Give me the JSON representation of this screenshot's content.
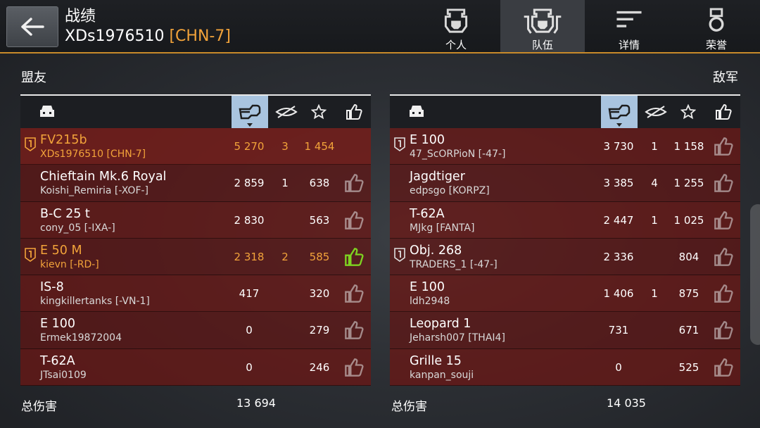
{
  "header": {
    "title": "战绩",
    "player": "XDs1976510",
    "clan": "[CHN-7]",
    "tabs": [
      {
        "label": "个人",
        "icon": "personal-helmet-icon"
      },
      {
        "label": "队伍",
        "icon": "team-helmets-icon"
      },
      {
        "label": "详情",
        "icon": "details-lines-icon"
      },
      {
        "label": "荣誉",
        "icon": "honor-medal-icon"
      }
    ],
    "active_tab": "队伍"
  },
  "allies": {
    "label": "盟友",
    "total_label": "总伤害",
    "total_damage": "13 694",
    "rows": [
      {
        "tank": "FV215b",
        "player": "XDs1976510 [CHN-7]",
        "damage": "5 270",
        "kills": "3",
        "xp": "1 454",
        "gold": true,
        "rank": true,
        "liked": false,
        "no_like": true
      },
      {
        "tank": "Chieftain Mk.6 Royal",
        "player": "Koishi_Remiria [-XOF-]",
        "damage": "2 859",
        "kills": "1",
        "xp": "638"
      },
      {
        "tank": "B-C 25 t",
        "player": "cony_05 [-IXA-]",
        "damage": "2 830",
        "kills": "",
        "xp": "563"
      },
      {
        "tank": "E 50 M",
        "player": "kievn [-RD-]",
        "damage": "2 318",
        "kills": "2",
        "xp": "585",
        "gold": true,
        "rank": true,
        "liked": true
      },
      {
        "tank": "IS-8",
        "player": "kingkillertanks [-VN-1]",
        "damage": "417",
        "kills": "",
        "xp": "320"
      },
      {
        "tank": "E 100",
        "player": "Ermek19872004",
        "damage": "0",
        "kills": "",
        "xp": "279"
      },
      {
        "tank": "T-62A",
        "player": "JTsai0109",
        "damage": "0",
        "kills": "",
        "xp": "246"
      }
    ]
  },
  "enemies": {
    "label": "敌军",
    "total_label": "总伤害",
    "total_damage": "14 035",
    "rows": [
      {
        "tank": "E 100",
        "player": "47_ScORPioN [-47-]",
        "damage": "3 730",
        "kills": "1",
        "xp": "1 158",
        "rank": true
      },
      {
        "tank": "Jagdtiger",
        "player": "edpsgo [KORPZ]",
        "damage": "3 385",
        "kills": "4",
        "xp": "1 255"
      },
      {
        "tank": "T-62A",
        "player": "MJkg [FANTA]",
        "damage": "2 447",
        "kills": "1",
        "xp": "1 025"
      },
      {
        "tank": "Obj. 268",
        "player": "TRADERS_1 [-47-]",
        "damage": "2 336",
        "kills": "",
        "xp": "804",
        "rank": true
      },
      {
        "tank": "E 100",
        "player": "ldh2948",
        "damage": "1 406",
        "kills": "1",
        "xp": "875"
      },
      {
        "tank": "Leopard 1",
        "player": "Jeharsh007 [THAI4]",
        "damage": "731",
        "kills": "",
        "xp": "671"
      },
      {
        "tank": "Grille 15",
        "player": "kanpan_souji",
        "damage": "0",
        "kills": "",
        "xp": "525"
      }
    ]
  },
  "colors": {
    "accent": "#f2a33a",
    "sort_active": "#a9c4df",
    "liked": "#7ed321",
    "row_red": "#6e1614"
  }
}
